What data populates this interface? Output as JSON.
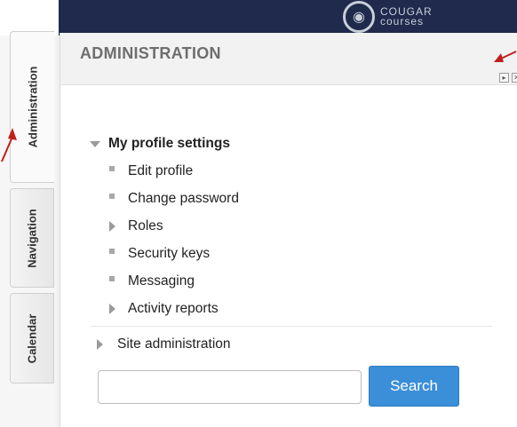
{
  "brand": {
    "logo_word1": "COUGAR",
    "logo_word2": "courses",
    "bar_color": "#1f2a4d"
  },
  "sidebar_tabs": {
    "administration": "Administration",
    "navigation": "Navigation",
    "calendar": "Calendar"
  },
  "panel": {
    "title": "ADMINISTRATION",
    "move_icon": "dock-icon",
    "close_icon": "close-icon"
  },
  "tree": {
    "section": "My profile settings",
    "items": [
      {
        "label": "Edit profile",
        "type": "leaf"
      },
      {
        "label": "Change password",
        "type": "leaf"
      },
      {
        "label": "Roles",
        "type": "branch"
      },
      {
        "label": "Security keys",
        "type": "leaf"
      },
      {
        "label": "Messaging",
        "type": "leaf"
      },
      {
        "label": "Activity reports",
        "type": "branch"
      }
    ],
    "site_admin": "Site administration"
  },
  "search": {
    "button_label": "Search",
    "placeholder": "",
    "value": ""
  },
  "colors": {
    "accent": "#3b8ed8",
    "annotation_arrow": "#c0201c"
  }
}
